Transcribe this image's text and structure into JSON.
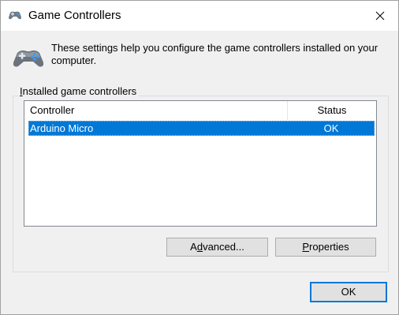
{
  "window": {
    "title": "Game Controllers",
    "icon": "gamepad-icon",
    "close_icon": "close-icon"
  },
  "header": {
    "icon": "gamepad-icon",
    "description": "These settings help you configure the game controllers installed on your computer."
  },
  "group": {
    "label_prefix": "I",
    "label_rest": "nstalled game controllers"
  },
  "list": {
    "columns": [
      "Controller",
      "Status"
    ],
    "rows": [
      {
        "controller": "Arduino Micro",
        "status": "OK",
        "selected": true
      }
    ]
  },
  "buttons": {
    "advanced_pre": "A",
    "advanced_ul": "d",
    "advanced_post": "vanced...",
    "properties_ul": "P",
    "properties_post": "roperties",
    "ok": "OK"
  },
  "colors": {
    "selection": "#0078d7",
    "window_bg": "#f0f0f0",
    "titlebar_bg": "#ffffff"
  }
}
